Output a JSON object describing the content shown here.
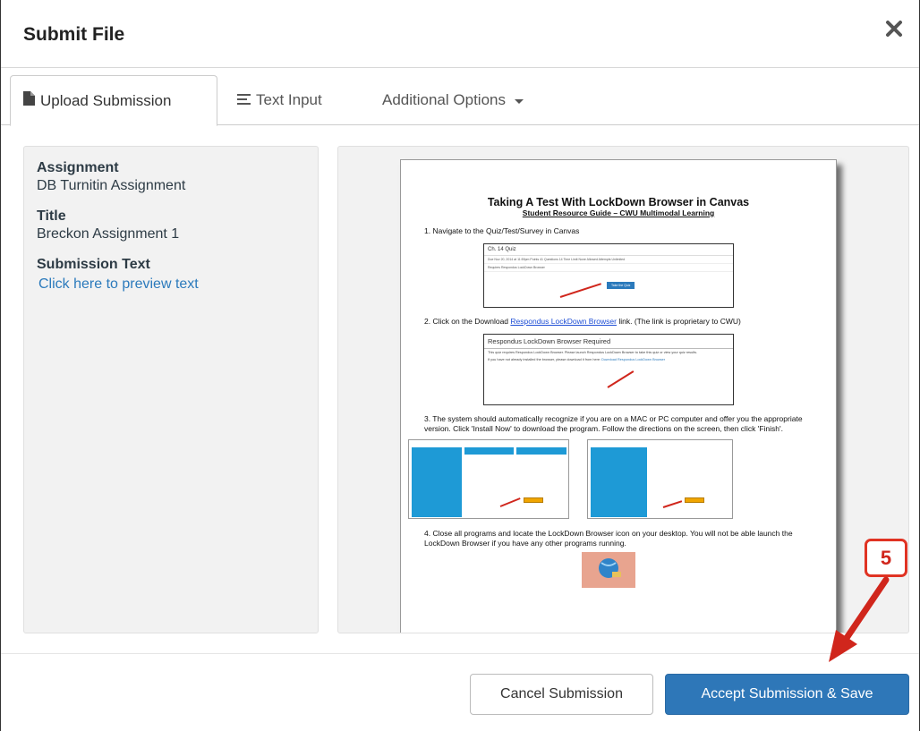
{
  "dialog": {
    "title": "Submit File",
    "close_icon": "close-icon"
  },
  "tabs": [
    {
      "label": "Upload Submission",
      "icon": "file-icon",
      "active": true
    },
    {
      "label": "Text Input",
      "icon": "align-left-icon",
      "active": false
    },
    {
      "label": "Additional Options",
      "icon": "caret-down-icon",
      "active": false
    }
  ],
  "details": {
    "assignment_label": "Assignment",
    "assignment_value": "DB Turnitin Assignment",
    "title_label": "Title",
    "title_value": "Breckon Assignment 1",
    "submission_text_label": "Submission Text",
    "preview_link": "Click here to preview text"
  },
  "document": {
    "title": "Taking A Test With LockDown Browser in Canvas",
    "subtitle": "Student Resource Guide – CWU Multimodal Learning",
    "step1": "1.  Navigate to the Quiz/Test/Survey in Canvas",
    "quiz_header": "Ch. 14 Quiz",
    "quiz_row": "Due Nov 20, 2014 at 11:59pm   Points 41   Questions 14   Time Limit None   Allowed Attempts Unlimited",
    "quiz_row2": "Requires Respondus LockDown Browser",
    "quiz_button": "Take the Quiz",
    "step2_prefix": "2.  Click on the Download ",
    "step2_link": "Respondus LockDown Browser",
    "step2_suffix": " link. (The link is proprietary to CWU)",
    "rld_title": "Respondus LockDown Browser Required",
    "rld_text1": "This quiz requires Respondus LockDown Browser. Please launch Respondus LockDown Browser to take this quiz or view your quiz results.",
    "rld_text2": "If you have not already installed the browser, please download it from here:",
    "rld_link": "Download Respondus LockDown Browser",
    "step3": "3.  The system should automatically recognize if you are on a MAC or PC computer and offer you the appropriate version.  Click 'Install Now' to download the program.  Follow the directions on the screen, then click 'Finish'.",
    "step4": "4.  Close all programs and locate the LockDown Browser icon on your desktop.  You will not be able launch the LockDown Browser if you have any other programs running."
  },
  "footer": {
    "cancel_label": "Cancel Submission",
    "accept_label": "Accept Submission & Save"
  },
  "callout": {
    "number": "5"
  },
  "colors": {
    "primary": "#2e77b8",
    "link": "#2b7abc",
    "annotation_red": "#d0261c"
  }
}
